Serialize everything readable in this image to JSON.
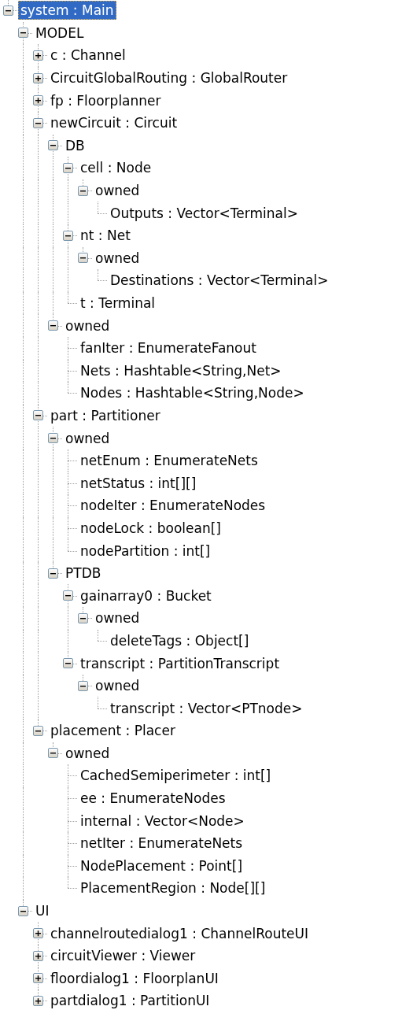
{
  "tree": [
    {
      "label": "system : Main",
      "expanded": true,
      "selected": true,
      "children": [
        {
          "label": "MODEL",
          "expanded": true,
          "selected": false,
          "children": [
            {
              "label": "c : Channel",
              "expanded": false,
              "selected": false
            },
            {
              "label": "CircuitGlobalRouting : GlobalRouter",
              "expanded": false,
              "selected": false
            },
            {
              "label": "fp : Floorplanner",
              "expanded": false,
              "selected": false
            },
            {
              "label": "newCircuit : Circuit",
              "expanded": true,
              "selected": false,
              "children": [
                {
                  "label": "DB",
                  "expanded": true,
                  "selected": false,
                  "children": [
                    {
                      "label": "cell : Node",
                      "expanded": true,
                      "selected": false,
                      "children": [
                        {
                          "label": "owned",
                          "expanded": true,
                          "selected": false,
                          "children": [
                            {
                              "label": "Outputs : Vector<Terminal>",
                              "selected": false
                            }
                          ]
                        }
                      ]
                    },
                    {
                      "label": "nt : Net",
                      "expanded": true,
                      "selected": false,
                      "children": [
                        {
                          "label": "owned",
                          "expanded": true,
                          "selected": false,
                          "children": [
                            {
                              "label": "Destinations : Vector<Terminal>",
                              "selected": false
                            }
                          ]
                        }
                      ]
                    },
                    {
                      "label": "t : Terminal",
                      "selected": false
                    }
                  ]
                },
                {
                  "label": "owned",
                  "expanded": true,
                  "selected": false,
                  "children": [
                    {
                      "label": "fanIter : EnumerateFanout",
                      "selected": false
                    },
                    {
                      "label": "Nets : Hashtable<String,Net>",
                      "selected": false
                    },
                    {
                      "label": "Nodes : Hashtable<String,Node>",
                      "selected": false
                    }
                  ]
                }
              ]
            },
            {
              "label": "part : Partitioner",
              "expanded": true,
              "selected": false,
              "children": [
                {
                  "label": "owned",
                  "expanded": true,
                  "selected": false,
                  "children": [
                    {
                      "label": "netEnum : EnumerateNets",
                      "selected": false
                    },
                    {
                      "label": "netStatus : int[][]",
                      "selected": false
                    },
                    {
                      "label": "nodeIter : EnumerateNodes",
                      "selected": false
                    },
                    {
                      "label": "nodeLock : boolean[]",
                      "selected": false
                    },
                    {
                      "label": "nodePartition : int[]",
                      "selected": false
                    }
                  ]
                },
                {
                  "label": "PTDB",
                  "expanded": true,
                  "selected": false,
                  "children": [
                    {
                      "label": "gainarray0 : Bucket",
                      "expanded": true,
                      "selected": false,
                      "children": [
                        {
                          "label": "owned",
                          "expanded": true,
                          "selected": false,
                          "children": [
                            {
                              "label": "deleteTags : Object[]",
                              "selected": false
                            }
                          ]
                        }
                      ]
                    },
                    {
                      "label": "transcript : PartitionTranscript",
                      "expanded": true,
                      "selected": false,
                      "children": [
                        {
                          "label": "owned",
                          "expanded": true,
                          "selected": false,
                          "children": [
                            {
                              "label": "transcript : Vector<PTnode>",
                              "selected": false
                            }
                          ]
                        }
                      ]
                    }
                  ]
                }
              ]
            },
            {
              "label": "placement : Placer",
              "expanded": true,
              "selected": false,
              "children": [
                {
                  "label": "owned",
                  "expanded": true,
                  "selected": false,
                  "children": [
                    {
                      "label": "CachedSemiperimeter : int[]",
                      "selected": false
                    },
                    {
                      "label": "ee : EnumerateNodes",
                      "selected": false
                    },
                    {
                      "label": "internal : Vector<Node>",
                      "selected": false
                    },
                    {
                      "label": "netIter : EnumerateNets",
                      "selected": false
                    },
                    {
                      "label": "NodePlacement : Point[]",
                      "selected": false
                    },
                    {
                      "label": "PlacementRegion : Node[][]",
                      "selected": false
                    }
                  ]
                }
              ]
            }
          ]
        },
        {
          "label": "UI",
          "expanded": true,
          "selected": false,
          "children": [
            {
              "label": "channelroutedialog1 : ChannelRouteUI",
              "expanded": false,
              "selected": false
            },
            {
              "label": "circuitViewer : Viewer",
              "expanded": false,
              "selected": false
            },
            {
              "label": "floordialog1 : FloorplanUI",
              "expanded": false,
              "selected": false
            },
            {
              "label": "partdialog1 : PartitionUI",
              "expanded": false,
              "selected": false
            }
          ]
        }
      ]
    }
  ]
}
